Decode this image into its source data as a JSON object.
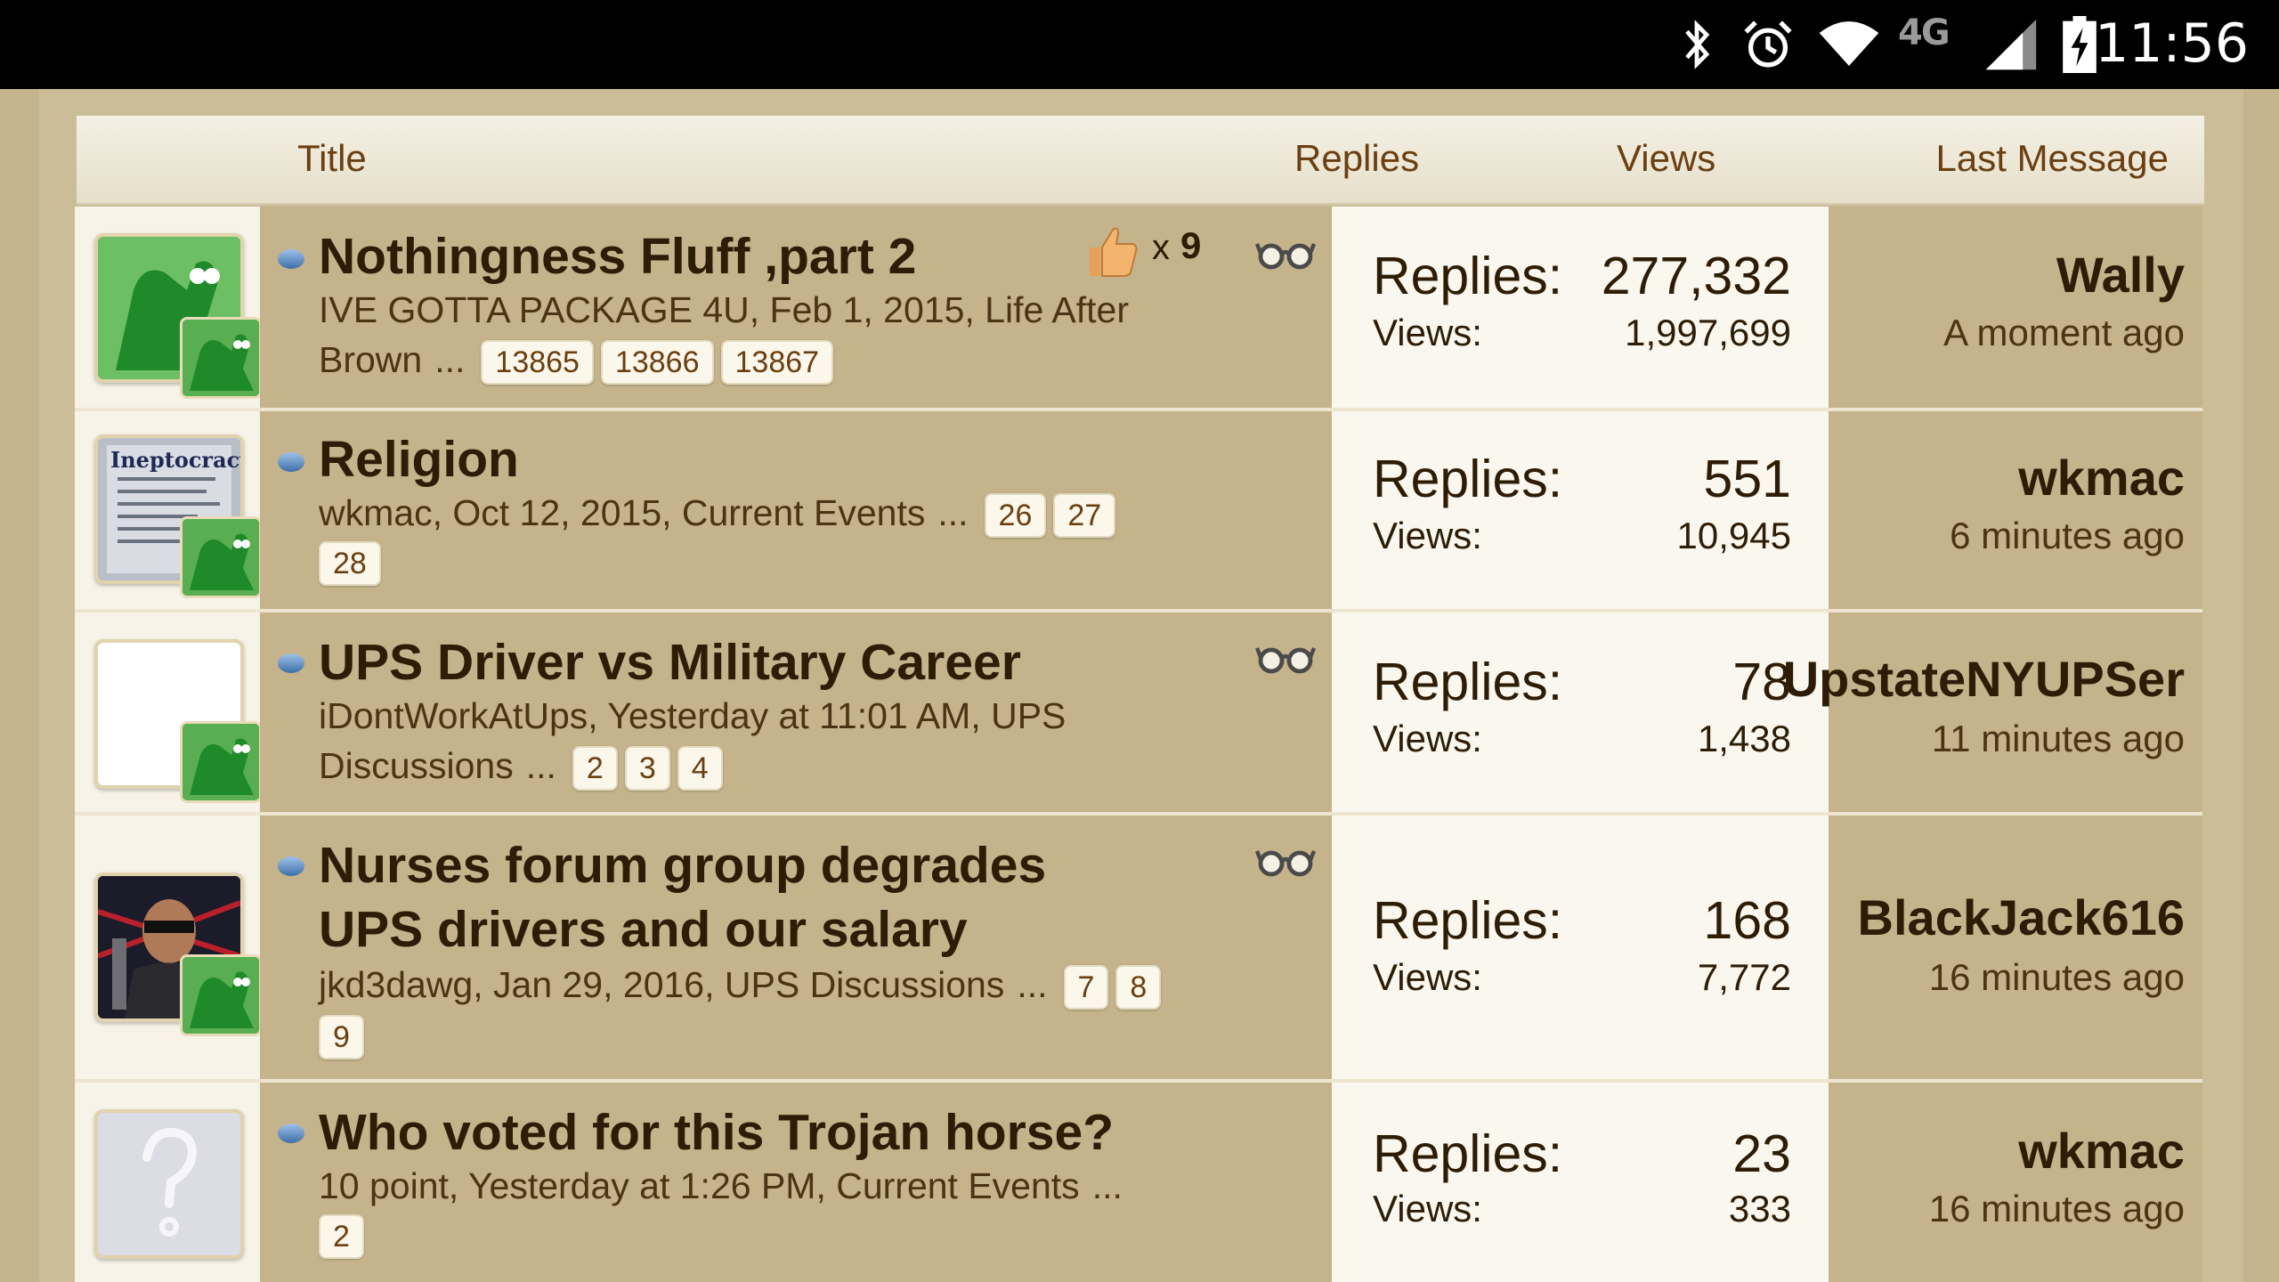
{
  "status_bar": {
    "time": "11:56",
    "network": "4G",
    "icons": [
      "bluetooth-icon",
      "alarm-icon",
      "wifi-icon",
      "signal-icon",
      "battery-charging-icon"
    ]
  },
  "header": {
    "title": "Title",
    "replies": "Replies",
    "views": "Views",
    "last_message": "Last Message"
  },
  "labels": {
    "replies": "Replies:",
    "views": "Views:",
    "ellipsis": "..."
  },
  "threads": [
    {
      "title": "Nothingness Fluff ,part 2",
      "meta_line1": "IVE GOTTA PACKAGE 4U, Feb 1, 2015, Life After",
      "meta_line2": "Brown",
      "pages": [
        "13865",
        "13866",
        "13867"
      ],
      "likes": "x",
      "likes_count": "9",
      "replies": "277,332",
      "views": "1,997,699",
      "last_user": "Wally",
      "last_time": "A moment ago"
    },
    {
      "title": "Religion",
      "meta_line1": "wkmac, Oct 12, 2015, Current Events",
      "pages": [
        "26",
        "27"
      ],
      "pages_line2": [
        "28"
      ],
      "avatar_text": "Ineptocracy",
      "replies": "551",
      "views": "10,945",
      "last_user": "wkmac",
      "last_time": "6 minutes ago"
    },
    {
      "title": "UPS Driver vs Military Career",
      "meta_line1": "iDontWorkAtUps, Yesterday at 11:01 AM, UPS",
      "meta_line2": "Discussions",
      "pages": [
        "2",
        "3",
        "4"
      ],
      "replies": "78",
      "views": "1,438",
      "last_user": "UpstateNYUPSer",
      "last_time": "11 minutes ago"
    },
    {
      "title_line1": "Nurses forum group degrades",
      "title_line2": "UPS drivers and our salary",
      "meta_line1": "jkd3dawg, Jan 29, 2016, UPS Discussions",
      "pages": [
        "7",
        "8"
      ],
      "pages_line2": [
        "9"
      ],
      "replies": "168",
      "views": "7,772",
      "last_user": "BlackJack616",
      "last_time": "16 minutes ago"
    },
    {
      "title": "Who voted for this Trojan horse?",
      "meta_line1": "10 point, Yesterday at 1:26 PM, Current Events",
      "pages_line2": [
        "2"
      ],
      "replies": "23",
      "views": "333",
      "last_user": "wkmac",
      "last_time": "16 minutes ago"
    }
  ],
  "colors": {
    "background": "#c4b48d",
    "row_main": "#c4b38b",
    "stats_bg": "#faf7ef",
    "link": "#6b3f12",
    "title_text": "#2e1d06"
  }
}
